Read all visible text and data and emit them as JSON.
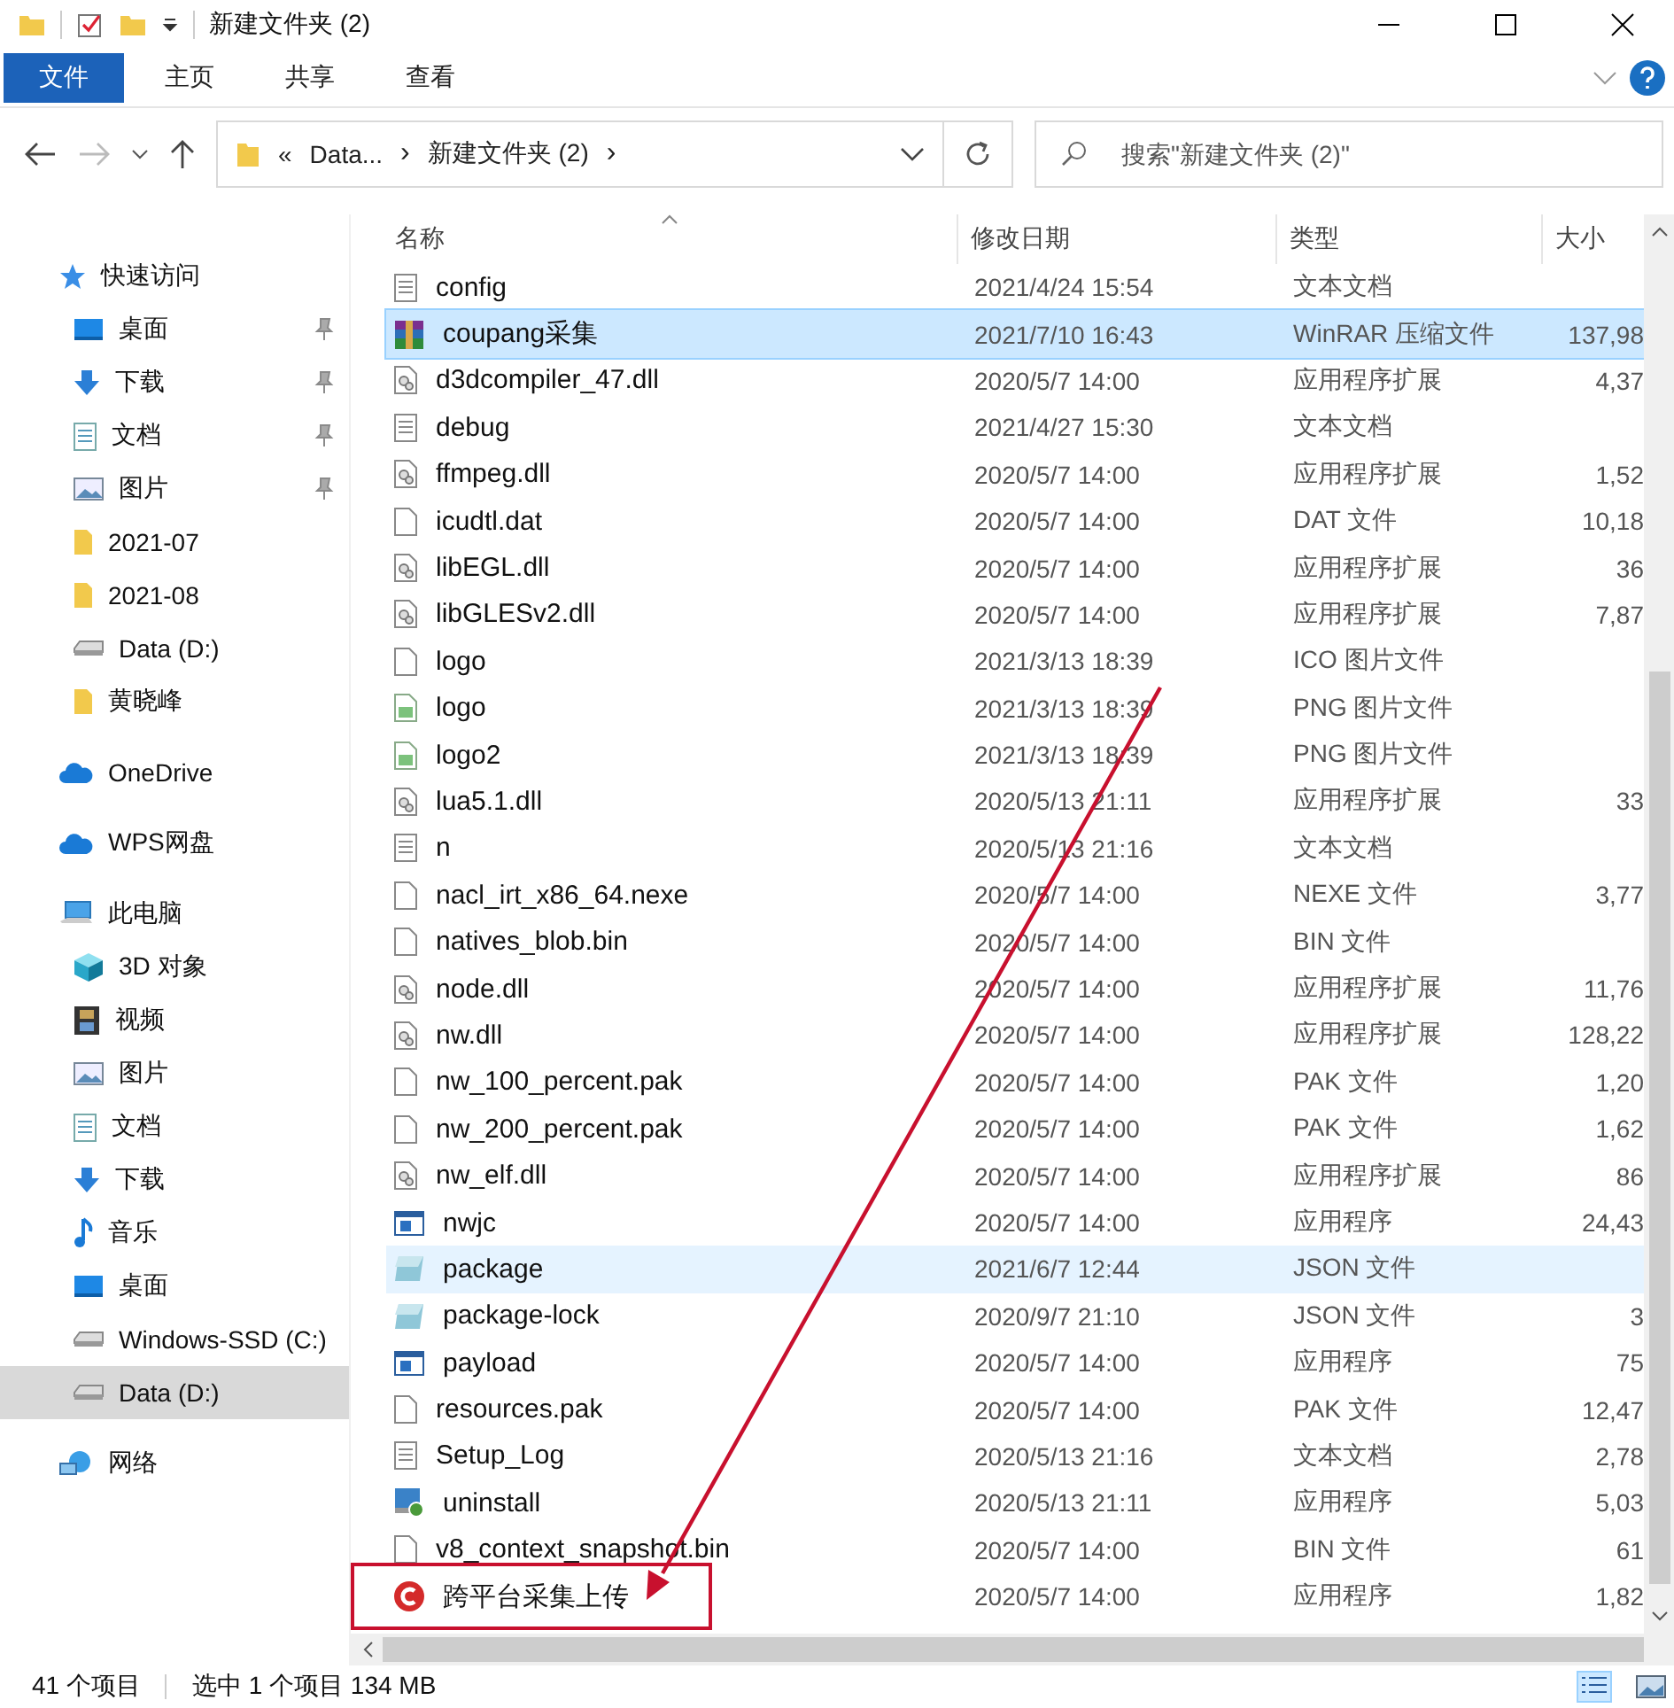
{
  "window": {
    "title": "新建文件夹 (2)"
  },
  "ribbon_tabs": [
    {
      "label": "文件",
      "selected": true
    },
    {
      "label": "主页",
      "selected": false
    },
    {
      "label": "共享",
      "selected": false
    },
    {
      "label": "查看",
      "selected": false
    }
  ],
  "address": {
    "overflow": "«",
    "crumbs": [
      "Data...",
      "新建文件夹 (2)"
    ],
    "separator": "›"
  },
  "search": {
    "placeholder": "搜索\"新建文件夹 (2)\""
  },
  "sidebar": [
    {
      "label": "快速访问",
      "kind": "star",
      "selected": false,
      "children": [
        {
          "label": "桌面",
          "kind": "desktop",
          "pinned": true,
          "selected": false
        },
        {
          "label": "下载",
          "kind": "download",
          "pinned": true,
          "selected": false
        },
        {
          "label": "文档",
          "kind": "document",
          "pinned": true,
          "selected": false
        },
        {
          "label": "图片",
          "kind": "image",
          "pinned": true,
          "selected": false
        },
        {
          "label": "2021-07",
          "kind": "folder",
          "pinned": false,
          "selected": false
        },
        {
          "label": "2021-08",
          "kind": "folder",
          "pinned": false,
          "selected": false
        },
        {
          "label": "Data (D:)",
          "kind": "drive",
          "pinned": false,
          "selected": false
        },
        {
          "label": "黄晓峰",
          "kind": "folder",
          "pinned": false,
          "selected": false
        }
      ]
    },
    {
      "label": "OneDrive",
      "kind": "cloud",
      "selected": false
    },
    {
      "label": "WPS网盘",
      "kind": "cloud",
      "selected": false
    },
    {
      "label": "此电脑",
      "kind": "computer",
      "selected": false,
      "children": [
        {
          "label": "3D 对象",
          "kind": "cube",
          "pinned": false,
          "selected": false
        },
        {
          "label": "视频",
          "kind": "video",
          "pinned": false,
          "selected": false
        },
        {
          "label": "图片",
          "kind": "image",
          "pinned": false,
          "selected": false
        },
        {
          "label": "文档",
          "kind": "document",
          "pinned": false,
          "selected": false
        },
        {
          "label": "下载",
          "kind": "download",
          "pinned": false,
          "selected": false
        },
        {
          "label": "音乐",
          "kind": "music",
          "pinned": false,
          "selected": false
        },
        {
          "label": "桌面",
          "kind": "desktop",
          "pinned": false,
          "selected": false
        },
        {
          "label": "Windows-SSD (C:)",
          "kind": "drive",
          "pinned": false,
          "selected": false
        },
        {
          "label": "Data (D:)",
          "kind": "drive",
          "pinned": false,
          "selected": true
        }
      ]
    },
    {
      "label": "网络",
      "kind": "network",
      "selected": false
    }
  ],
  "table": {
    "columns": [
      "名称",
      "修改日期",
      "类型",
      "大小"
    ],
    "rows": [
      {
        "name": "config",
        "date": "2021/4/24 15:54",
        "type": "文本文档",
        "kind": "text",
        "selected": false,
        "hovered": false
      },
      {
        "name": "coupang采集",
        "date": "2021/7/10 16:43",
        "type": "WinRAR 压缩文件",
        "size": "137,98",
        "kind": "archive",
        "selected": true,
        "hovered": false
      },
      {
        "name": "d3dcompiler_47.dll",
        "date": "2020/5/7 14:00",
        "type": "应用程序扩展",
        "size": "4,37",
        "kind": "dll",
        "selected": false,
        "hovered": false
      },
      {
        "name": "debug",
        "date": "2021/4/27 15:30",
        "type": "文本文档",
        "kind": "text",
        "selected": false,
        "hovered": false
      },
      {
        "name": "ffmpeg.dll",
        "date": "2020/5/7 14:00",
        "type": "应用程序扩展",
        "size": "1,52",
        "kind": "dll",
        "selected": false,
        "hovered": false
      },
      {
        "name": "icudtl.dat",
        "date": "2020/5/7 14:00",
        "type": "DAT 文件",
        "size": "10,18",
        "kind": "blank",
        "selected": false,
        "hovered": false
      },
      {
        "name": "libEGL.dll",
        "date": "2020/5/7 14:00",
        "type": "应用程序扩展",
        "size": "36",
        "kind": "dll",
        "selected": false,
        "hovered": false
      },
      {
        "name": "libGLESv2.dll",
        "date": "2020/5/7 14:00",
        "type": "应用程序扩展",
        "size": "7,87",
        "kind": "dll",
        "selected": false,
        "hovered": false
      },
      {
        "name": "logo",
        "date": "2021/3/13 18:39",
        "type": "ICO 图片文件",
        "kind": "blank",
        "selected": false,
        "hovered": false
      },
      {
        "name": "logo",
        "date": "2021/3/13 18:39",
        "type": "PNG 图片文件",
        "kind": "png",
        "selected": false,
        "hovered": false
      },
      {
        "name": "logo2",
        "date": "2021/3/13 18:39",
        "type": "PNG 图片文件",
        "kind": "png",
        "selected": false,
        "hovered": false
      },
      {
        "name": "lua5.1.dll",
        "date": "2020/5/13 21:11",
        "type": "应用程序扩展",
        "size": "33",
        "kind": "dll",
        "selected": false,
        "hovered": false
      },
      {
        "name": "n",
        "date": "2020/5/13 21:16",
        "type": "文本文档",
        "kind": "text",
        "selected": false,
        "hovered": false
      },
      {
        "name": "nacl_irt_x86_64.nexe",
        "date": "2020/5/7 14:00",
        "type": "NEXE 文件",
        "size": "3,77",
        "kind": "blank",
        "selected": false,
        "hovered": false
      },
      {
        "name": "natives_blob.bin",
        "date": "2020/5/7 14:00",
        "type": "BIN 文件",
        "kind": "blank",
        "selected": false,
        "hovered": false
      },
      {
        "name": "node.dll",
        "date": "2020/5/7 14:00",
        "type": "应用程序扩展",
        "size": "11,76",
        "kind": "dll",
        "selected": false,
        "hovered": false
      },
      {
        "name": "nw.dll",
        "date": "2020/5/7 14:00",
        "type": "应用程序扩展",
        "size": "128,22",
        "kind": "dll",
        "selected": false,
        "hovered": false
      },
      {
        "name": "nw_100_percent.pak",
        "date": "2020/5/7 14:00",
        "type": "PAK 文件",
        "size": "1,20",
        "kind": "blank",
        "selected": false,
        "hovered": false
      },
      {
        "name": "nw_200_percent.pak",
        "date": "2020/5/7 14:00",
        "type": "PAK 文件",
        "size": "1,62",
        "kind": "blank",
        "selected": false,
        "hovered": false
      },
      {
        "name": "nw_elf.dll",
        "date": "2020/5/7 14:00",
        "type": "应用程序扩展",
        "size": "86",
        "kind": "dll",
        "selected": false,
        "hovered": false
      },
      {
        "name": "nwjc",
        "date": "2020/5/7 14:00",
        "type": "应用程序",
        "size": "24,43",
        "kind": "app",
        "selected": false,
        "hovered": false
      },
      {
        "name": "package",
        "date": "2021/6/7 12:44",
        "type": "JSON 文件",
        "kind": "json",
        "selected": false,
        "hovered": true
      },
      {
        "name": "package-lock",
        "date": "2020/9/7 21:10",
        "type": "JSON 文件",
        "size": "3",
        "kind": "json",
        "selected": false,
        "hovered": false
      },
      {
        "name": "payload",
        "date": "2020/5/7 14:00",
        "type": "应用程序",
        "size": "75",
        "kind": "app",
        "selected": false,
        "hovered": false
      },
      {
        "name": "resources.pak",
        "date": "2020/5/7 14:00",
        "type": "PAK 文件",
        "size": "12,47",
        "kind": "blank",
        "selected": false,
        "hovered": false
      },
      {
        "name": "Setup_Log",
        "date": "2020/5/13 21:16",
        "type": "文本文档",
        "size": "2,78",
        "kind": "text",
        "selected": false,
        "hovered": false
      },
      {
        "name": "uninstall",
        "date": "2020/5/13 21:11",
        "type": "应用程序",
        "size": "5,03",
        "kind": "setup",
        "selected": false,
        "hovered": false
      },
      {
        "name": "v8_context_snapshot.bin",
        "date": "2020/5/7 14:00",
        "type": "BIN 文件",
        "size": "61",
        "kind": "blank",
        "selected": false,
        "hovered": false
      },
      {
        "name": "跨平台采集上传",
        "date": "2020/5/7 14:00",
        "type": "应用程序",
        "size": "1,82",
        "kind": "redc",
        "selected": false,
        "hovered": false,
        "boxed": true
      }
    ]
  },
  "status_bar": {
    "count": "41 个项目",
    "selection": "选中 1 个项目  134 MB"
  }
}
